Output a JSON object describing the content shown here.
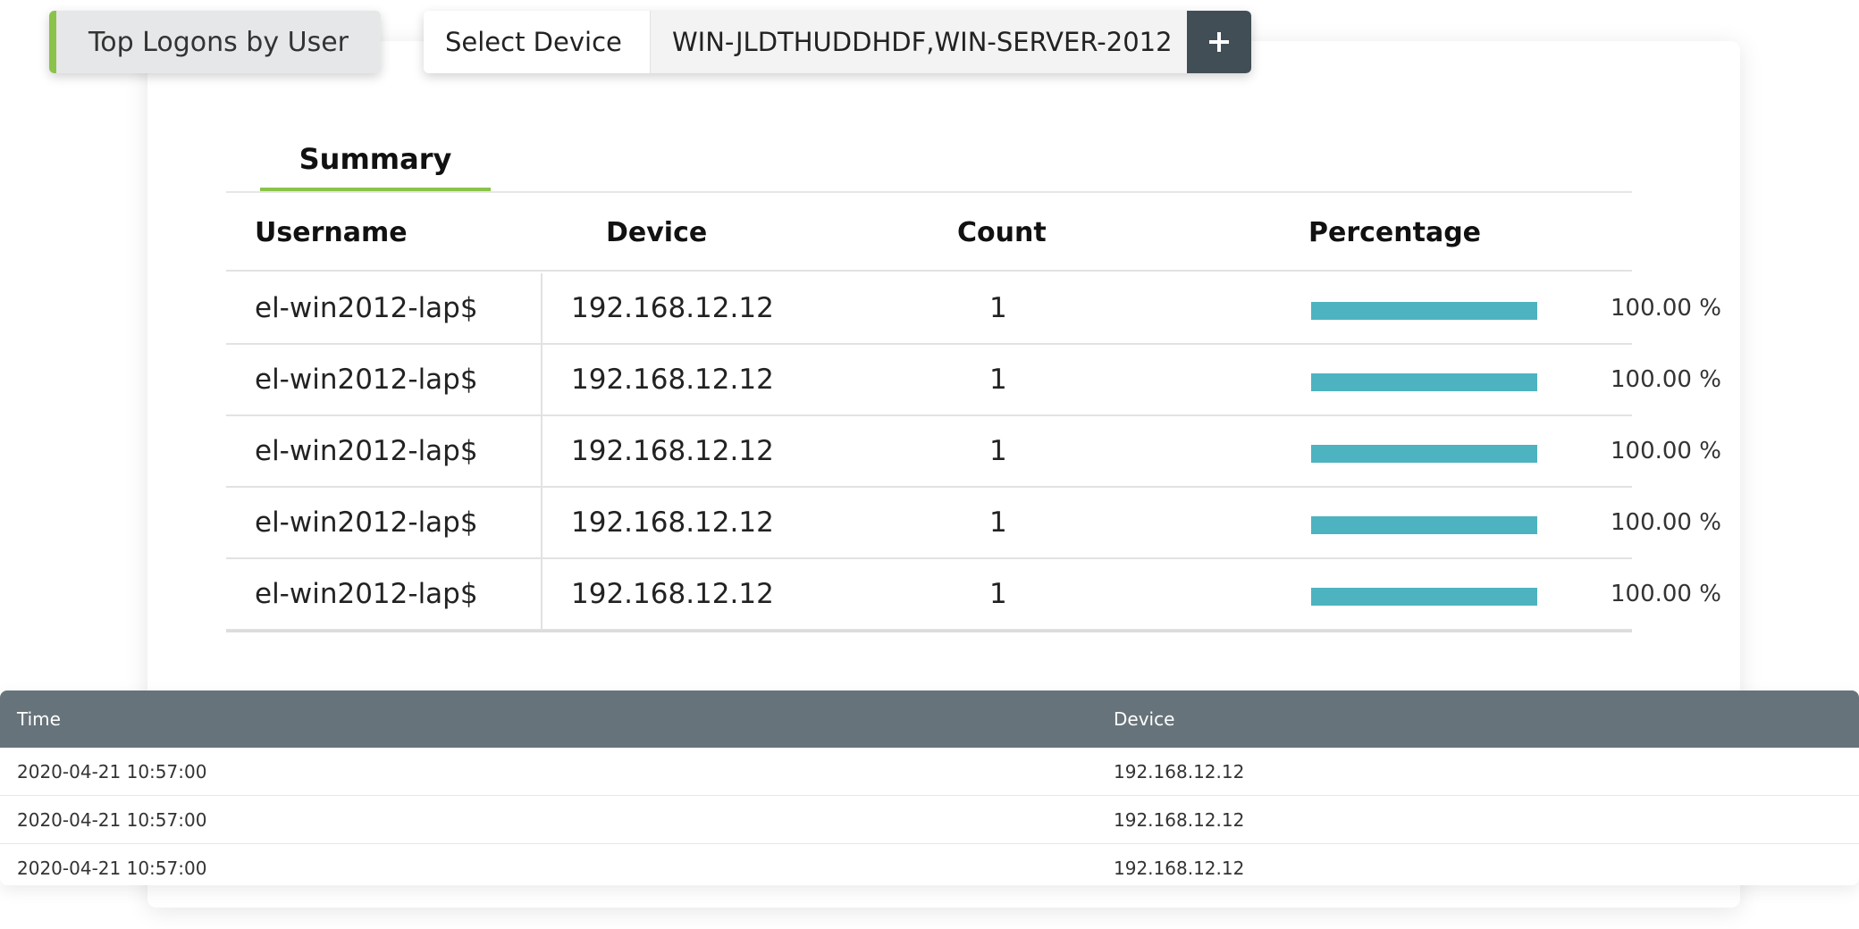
{
  "report_tab": {
    "label": "Top Logons by User"
  },
  "device_select": {
    "label": "Select Device",
    "value": "WIN-JLDTHUDDHDF,WIN-SERVER-2012",
    "add_icon": "plus-icon"
  },
  "tabs": [
    {
      "label": "Summary",
      "active": true
    }
  ],
  "summary_table": {
    "headers": {
      "username": "Username",
      "device": "Device",
      "count": "Count",
      "percentage": "Percentage"
    },
    "rows": [
      {
        "username": "el-win2012-lap$",
        "device": "192.168.12.12",
        "count": "1",
        "percent_value": 100,
        "percentage": "100.00 %"
      },
      {
        "username": "el-win2012-lap$",
        "device": "192.168.12.12",
        "count": "1",
        "percent_value": 100,
        "percentage": "100.00 %"
      },
      {
        "username": "el-win2012-lap$",
        "device": "192.168.12.12",
        "count": "1",
        "percent_value": 100,
        "percentage": "100.00 %"
      },
      {
        "username": "el-win2012-lap$",
        "device": "192.168.12.12",
        "count": "1",
        "percent_value": 100,
        "percentage": "100.00 %"
      },
      {
        "username": "el-win2012-lap$",
        "device": "192.168.12.12",
        "count": "1",
        "percent_value": 100,
        "percentage": "100.00 %"
      }
    ]
  },
  "detail_table": {
    "headers": {
      "time": "Time",
      "device": "Device"
    },
    "rows": [
      {
        "time": "2020-04-21 10:57:00",
        "device": "192.168.12.12"
      },
      {
        "time": "2020-04-21 10:57:00",
        "device": "192.168.12.12"
      },
      {
        "time": "2020-04-21 10:57:00",
        "device": "192.168.12.12"
      }
    ]
  },
  "colors": {
    "accent_green": "#8bc34a",
    "bar_teal": "#4db3c1",
    "grid_header": "#67737a",
    "add_button": "#424e56"
  }
}
